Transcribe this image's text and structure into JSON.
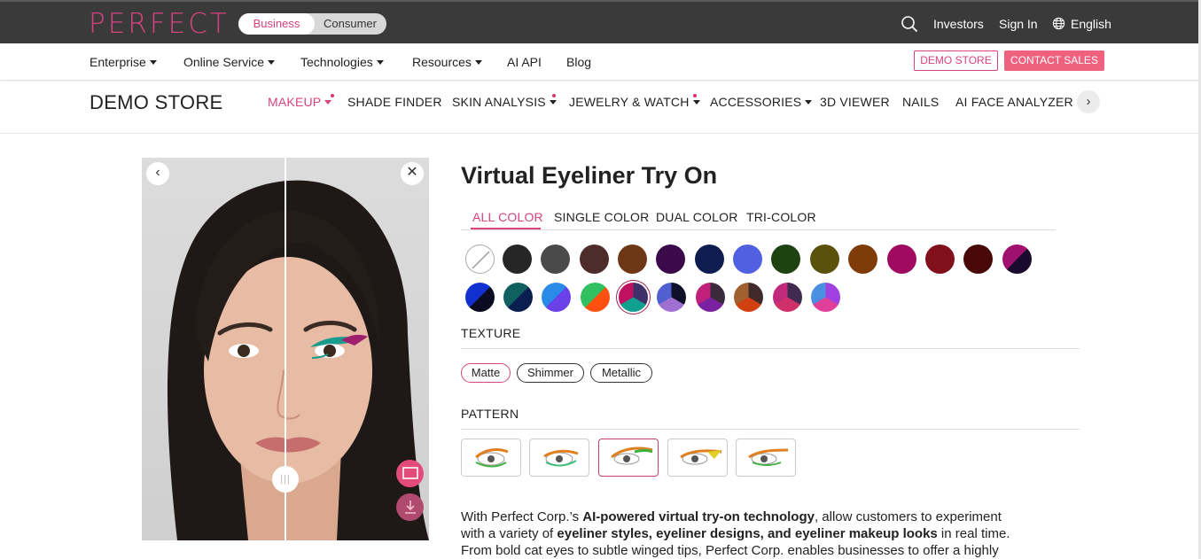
{
  "topbar": {
    "logo": "PERFECT",
    "toggle": {
      "business": "Business",
      "consumer": "Consumer"
    },
    "investors": "Investors",
    "sign_in": "Sign In",
    "language": "English"
  },
  "nav": {
    "items": [
      "Enterprise",
      "Online Service",
      "Technologies",
      "Resources",
      "AI API",
      "Blog"
    ],
    "demo_store_btn": "DEMO STORE",
    "contact_sales_btn": "CONTACT SALES"
  },
  "store": {
    "title": "DEMO STORE",
    "tabs": [
      "MAKEUP",
      "SHADE FINDER",
      "SKIN ANALYSIS",
      "JEWELRY & WATCH",
      "ACCESSORIES",
      "3D VIEWER",
      "NAILS",
      "AI FACE ANALYZER"
    ]
  },
  "product": {
    "title": "Virtual Eyeliner Try On",
    "color_tabs": [
      "ALL COLOR",
      "SINGLE COLOR",
      "DUAL COLOR",
      "TRI-COLOR"
    ],
    "texture_label": "TEXTURE",
    "textures": [
      "Matte",
      "Shimmer",
      "Metallic"
    ],
    "pattern_label": "PATTERN",
    "description": {
      "p1": "With Perfect Corp.’s ",
      "b1": "AI-powered virtual try-on technology",
      "p2": ", allow customers to experiment",
      "p3": "with a variety of ",
      "b2": "eyeliner styles, eyeliner designs, and eyeliner makeup looks",
      "p4": " in real time.",
      "p5": "From bold cat eyes to subtle winged tips, Perfect Corp. enables businesses to offer a highly"
    }
  },
  "colors": {
    "accent": "#d6437e",
    "topbar": "#3a3a3a",
    "contact": "#f0607f"
  },
  "swatches_row1": [
    "none",
    "#262626",
    "#4a4a4a",
    "#4e2c2a",
    "#6e3816",
    "#3a0a4a",
    "#0e1c50",
    "#5060e0",
    "#1e4210",
    "#5a520c",
    "#803c08",
    "#a00a60",
    "#82101c",
    "#480808",
    "#a0106e/#1a0a2e"
  ],
  "swatches_row2": [
    "#1030d0/#0a0a20",
    "#106060/#0a1e50",
    "#2a8ae8/#6a40e8",
    "#30c060/#ff5010",
    "#c01060/#40306a/#10a090",
    "#5060d0/#10102a/#a070d0",
    "#c0207a/#3a2a3a/#7a20a0",
    "#a06030/#402a2a/#d04010",
    "#c02a7a/#402a50/#d0306a",
    "#4a90e0/#a040e0/#e0409a"
  ]
}
